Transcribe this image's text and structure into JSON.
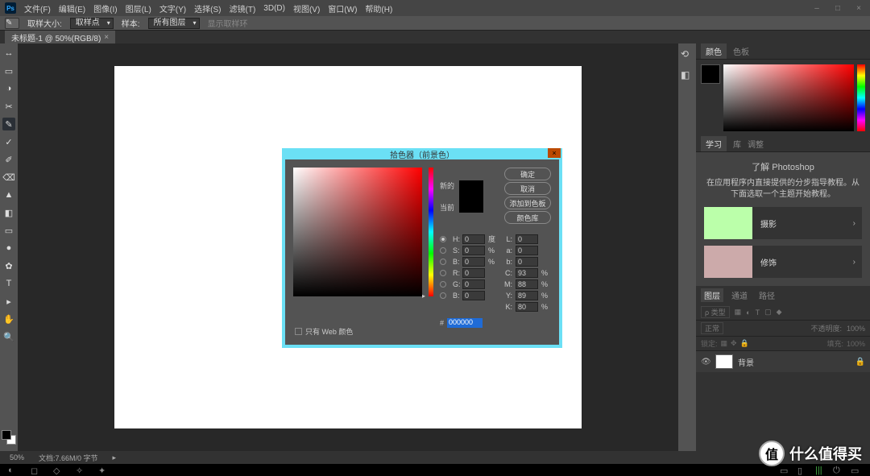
{
  "menubar": {
    "items": [
      "文件(F)",
      "编辑(E)",
      "图像(I)",
      "图层(L)",
      "文字(Y)",
      "选择(S)",
      "滤镜(T)",
      "3D(D)",
      "视图(V)",
      "窗口(W)",
      "帮助(H)"
    ]
  },
  "winctrl": {
    "min": "–",
    "max": "□",
    "close": "×"
  },
  "optbar": {
    "label_sample_size": "取样大小:",
    "sample_size_value": "取样点",
    "label_sample": "样本:",
    "sample_value": "所有图层",
    "hint": "显示取样环"
  },
  "doctab": {
    "title": "未标题-1 @ 50%(RGB/8)",
    "close": "×"
  },
  "tools": [
    "↔",
    "▭",
    "◑",
    "✂",
    "✎",
    "✓",
    "✐",
    "⌫",
    "▲",
    "◧",
    "▭",
    "●",
    "✿",
    "T",
    "▸",
    "✋",
    "🔍"
  ],
  "rightpanels": {
    "color_tabs": [
      "颜色",
      "色板"
    ],
    "learn_tabs": [
      "学习",
      "库",
      "调整"
    ],
    "learn_title": "了解 Photoshop",
    "learn_body": "在应用程序内直接提供的分步指导教程。从下面选取一个主题开始教程。",
    "learn_rows": [
      {
        "label": "摄影",
        "arrow": "›"
      },
      {
        "label": "修饰",
        "arrow": "›"
      }
    ],
    "layers_tabs": [
      "图层",
      "通道",
      "路径"
    ],
    "layers_search_placeholder": "ρ 类型",
    "layers_mode": "正常",
    "layers_opacity_label": "不透明度:",
    "layers_opacity_value": "100%",
    "layers_lock_label": "锁定:",
    "layers_fill_label": "填充:",
    "layers_fill_value": "100%",
    "layer_name": "背景",
    "lock_glyph": "🔒",
    "eye_glyph": "👁"
  },
  "statusbar": {
    "zoom": "50%",
    "docinfo": "文档:7.66M/0 字节",
    "arrow": "▸"
  },
  "dialog": {
    "title": "拾色器（前景色）",
    "close": "×",
    "btn_ok": "确定",
    "btn_cancel": "取消",
    "btn_addswatch": "添加到色板",
    "btn_libraries": "颜色库",
    "lbl_new": "新的",
    "lbl_current": "当前",
    "H": {
      "lbl": "H:",
      "val": "0",
      "unit": "度"
    },
    "S": {
      "lbl": "S:",
      "val": "0",
      "unit": "%"
    },
    "B": {
      "lbl": "B:",
      "val": "0",
      "unit": "%"
    },
    "R": {
      "lbl": "R:",
      "val": "0",
      "unit": ""
    },
    "G": {
      "lbl": "G:",
      "val": "0",
      "unit": ""
    },
    "Bb": {
      "lbl": "B:",
      "val": "0",
      "unit": ""
    },
    "L": {
      "lbl": "L:",
      "val": "0",
      "unit": ""
    },
    "a": {
      "lbl": "a:",
      "val": "0",
      "unit": ""
    },
    "b": {
      "lbl": "b:",
      "val": "0",
      "unit": ""
    },
    "C": {
      "lbl": "C:",
      "val": "93",
      "unit": "%"
    },
    "M": {
      "lbl": "M:",
      "val": "88",
      "unit": "%"
    },
    "Y": {
      "lbl": "Y:",
      "val": "89",
      "unit": "%"
    },
    "K": {
      "lbl": "K:",
      "val": "80",
      "unit": "%"
    },
    "hex_lbl": "#",
    "hex_val": "000000",
    "webonly": "只有 Web 颜色"
  },
  "badge": {
    "char": "值",
    "text": "什么值得买"
  }
}
